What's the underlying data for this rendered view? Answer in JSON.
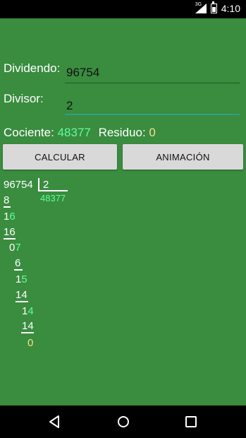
{
  "status": {
    "network": "3G",
    "time": "4:10"
  },
  "form": {
    "dividend_label": "Dividendo:",
    "dividend_value": "96754",
    "divisor_label": "Divisor:",
    "divisor_value": "2"
  },
  "result": {
    "quotient_label": "Cociente:",
    "quotient_value": "48377",
    "remainder_label": "Residuo:",
    "remainder_value": "0"
  },
  "buttons": {
    "calculate": "CALCULAR",
    "animate": "ANIMACIÓN"
  },
  "division": {
    "dividend": "96754",
    "divisor": "2",
    "quotient": "48377",
    "steps": [
      {
        "a": "8"
      },
      {
        "a": "1",
        "b": "6"
      },
      {
        "a": "16"
      },
      {
        "a": "0",
        "b": "7"
      },
      {
        "a": "6"
      },
      {
        "a": "1",
        "b": "5"
      },
      {
        "a": "14"
      },
      {
        "a": "1",
        "b": "4"
      },
      {
        "a": "14"
      },
      {
        "a": "0"
      }
    ]
  },
  "colors": {
    "background": "#3a8c3f",
    "accent_green": "#5dff9c",
    "remainder_yellow": "#f5e28a"
  }
}
